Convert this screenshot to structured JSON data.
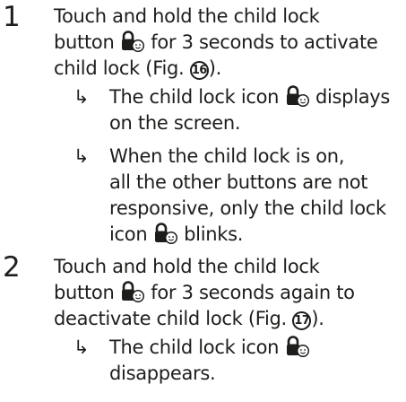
{
  "steps": [
    {
      "number": "1",
      "lines": [
        "Touch and hold the child lock",
        "button",
        "for 3 seconds to activate",
        "child lock (Fig.",
        "16",
        ")."
      ],
      "bullets": [
        {
          "arrow": "↳",
          "lines": [
            "The child lock icon",
            "displays",
            "on the screen."
          ]
        },
        {
          "arrow": "↳",
          "lines": [
            "When the child lock is on,",
            "all the other buttons are not",
            "responsive, only the child lock",
            "icon",
            "blinks."
          ]
        }
      ]
    },
    {
      "number": "2",
      "lines": [
        "Touch and hold the child lock",
        "button",
        "for 3 seconds again to",
        "deactivate child lock (Fig.",
        "17",
        ")."
      ],
      "bullets": [
        {
          "arrow": "↳",
          "lines": [
            "The child lock icon",
            "disappears."
          ]
        }
      ]
    }
  ],
  "icons": {
    "lock": "child-lock-icon"
  }
}
